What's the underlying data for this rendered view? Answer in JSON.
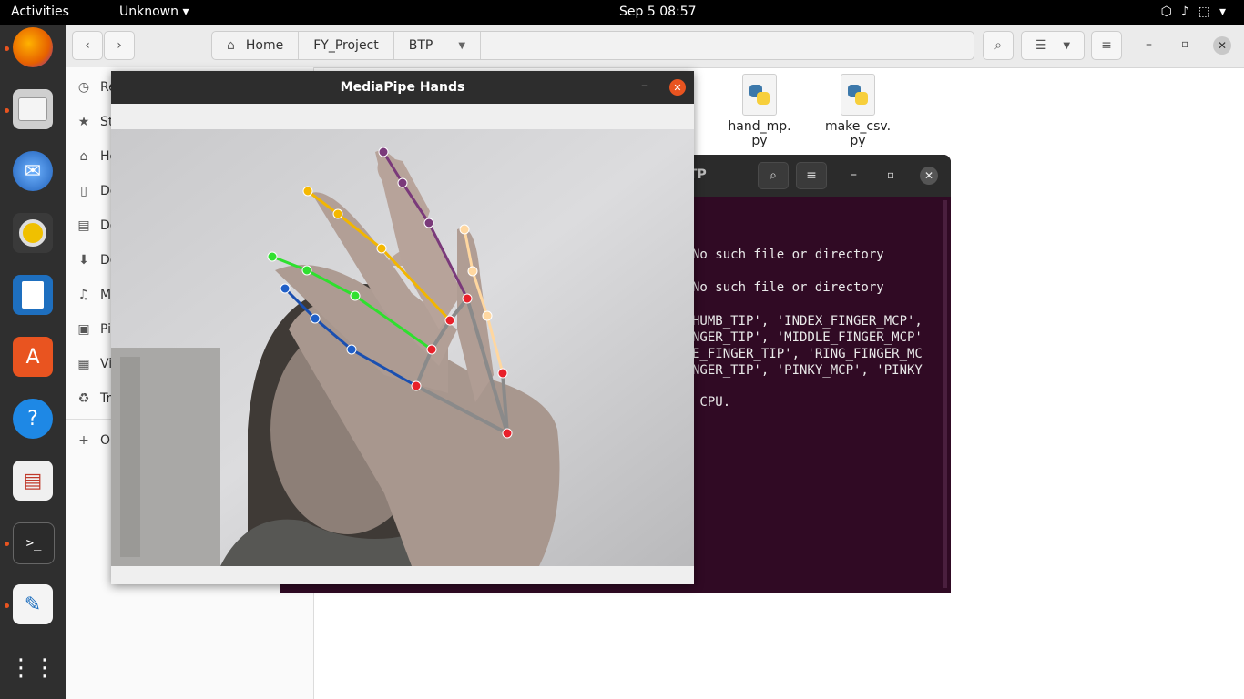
{
  "topbar": {
    "activities": "Activities",
    "app_menu": "Unknown ▾",
    "clock": "Sep 5  08:57",
    "tray": [
      "⬡",
      "♪",
      "⬚",
      "▾"
    ]
  },
  "dock": {
    "items": [
      "firefox-icon",
      "files-icon",
      "thunderbird-icon",
      "rhythmbox-icon",
      "writer-icon",
      "software-icon",
      "help-icon",
      "document-viewer-icon",
      "terminal-icon",
      "text-editor-icon",
      "show-apps-icon"
    ]
  },
  "files": {
    "breadcrumbs": [
      "Home",
      "FY_Project",
      "BTP"
    ],
    "sidebar": [
      {
        "icon": "◷",
        "label": "Re"
      },
      {
        "icon": "★",
        "label": "St"
      },
      {
        "icon": "⌂",
        "label": "Ho"
      },
      {
        "icon": "▯",
        "label": "De"
      },
      {
        "icon": "▤",
        "label": "Do"
      },
      {
        "icon": "⬇",
        "label": "Do"
      },
      {
        "icon": "♫",
        "label": "Mu"
      },
      {
        "icon": "▣",
        "label": "Pi"
      },
      {
        "icon": "▦",
        "label": "Vi"
      },
      {
        "icon": "♻",
        "label": "Tr"
      },
      {
        "icon": "+",
        "label": "O"
      }
    ],
    "icons": [
      {
        "line1": "hand_mp.",
        "line2": "py"
      },
      {
        "line1": "make_csv.",
        "line2": "py"
      }
    ]
  },
  "terminal": {
    "title_fragment": "TP",
    "lines": [
      "No such file or directory",
      "No such file or directory",
      "HUMB_TIP', 'INDEX_FINGER_MCP',",
      "NGER_TIP', 'MIDDLE_FINGER_MCP'",
      "E_FINGER_TIP', 'RING_FINGER_MC",
      "NGER_TIP', 'PINKY_MCP', 'PINKY",
      " CPU."
    ]
  },
  "mediapipe": {
    "title": "MediaPipe Hands"
  }
}
